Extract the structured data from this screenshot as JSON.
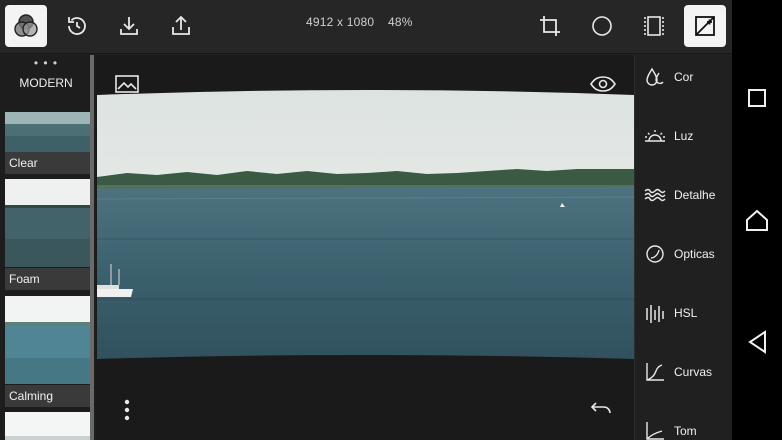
{
  "toolbar": {
    "buttons": [
      {
        "name": "filters-icon",
        "active": true
      },
      {
        "name": "history-icon"
      },
      {
        "name": "save-icon"
      },
      {
        "name": "share-icon"
      }
    ],
    "image_size": "4912 x 1080",
    "zoom": "48%",
    "right_buttons": [
      {
        "name": "crop-icon"
      },
      {
        "name": "circle-icon"
      },
      {
        "name": "frame-icon"
      },
      {
        "name": "adjustments-icon",
        "active": true
      }
    ]
  },
  "filters_panel": {
    "more": "• • •",
    "category": "MODERN",
    "items": [
      {
        "label": "Clear"
      },
      {
        "label": "Foam"
      },
      {
        "label": "Calming"
      }
    ]
  },
  "canvas": {
    "top_left_icon": "image-icon",
    "top_right_icon": "eye-icon",
    "bottom_left_icon": "more-vertical-icon",
    "bottom_right_icon": "undo-arrow-icon"
  },
  "adjust_panel": {
    "tools": [
      {
        "label": "Cor",
        "icon": "color-drops-icon"
      },
      {
        "label": "Luz",
        "icon": "sunrise-icon"
      },
      {
        "label": "Detalhe",
        "icon": "waves-icon"
      },
      {
        "label": "Opticas",
        "icon": "lens-icon"
      },
      {
        "label": "HSL",
        "icon": "hsl-bars-icon"
      },
      {
        "label": "Curvas",
        "icon": "curve-icon"
      },
      {
        "label": "Tom",
        "icon": "tone-icon"
      }
    ]
  },
  "system_nav": {
    "buttons": [
      "recents-icon",
      "home-icon",
      "back-icon"
    ]
  },
  "colors": {
    "background": "#212121",
    "toolbar": "#262626",
    "active_button": "#f4f4f4",
    "water": "#3b5f6c",
    "sky": "#e6ebe8"
  }
}
